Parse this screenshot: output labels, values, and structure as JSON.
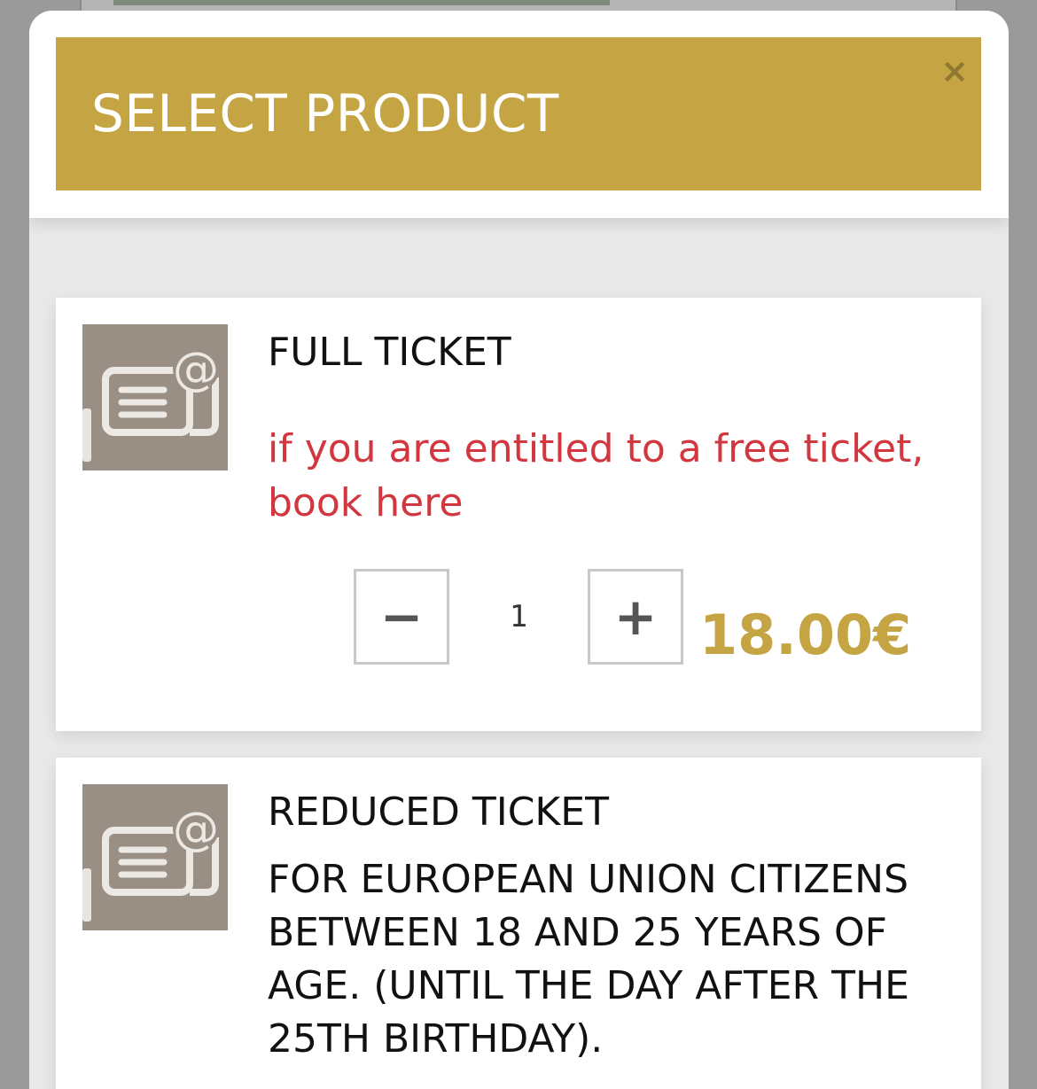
{
  "modal": {
    "title": "SELECT PRODUCT",
    "close_glyph": "×",
    "accent_color": "#c4a443"
  },
  "products": [
    {
      "name": "FULL TICKET",
      "icon": "e-ticket-icon",
      "free_ticket_link": "if you are entitled to a free ticket, book here",
      "quantity": "1",
      "minus_glyph": "−",
      "plus_glyph": "+",
      "price": "18.00€"
    },
    {
      "name": "REDUCED TICKET",
      "icon": "e-ticket-icon",
      "description": "FOR EUROPEAN UNION CITIZENS BETWEEN 18 AND 25 YEARS OF AGE. (UNTIL THE DAY AFTER THE 25TH BIRTHDAY)."
    }
  ],
  "colors": {
    "link_red": "#d2373f",
    "price_gold": "#c4a443",
    "thumb_bg": "#9a8f84"
  }
}
